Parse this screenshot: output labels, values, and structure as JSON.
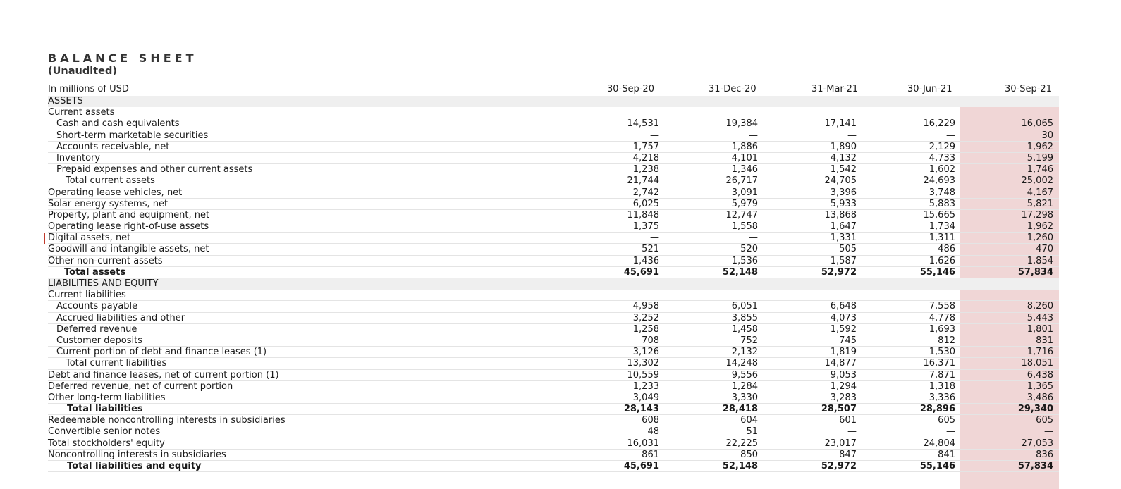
{
  "title": "BALANCE SHEET",
  "subtitle": "(Unaudited)",
  "unit_label": "In millions of USD",
  "columns": [
    "30-Sep-20",
    "31-Dec-20",
    "31-Mar-21",
    "30-Jun-21",
    "30-Sep-21"
  ],
  "highlight_color": "#f0d6d6",
  "rows": [
    {
      "label": "ASSETS",
      "type": "section",
      "indent": 0,
      "values": [
        "",
        "",
        "",
        "",
        ""
      ]
    },
    {
      "label": "Current assets",
      "type": "plain",
      "indent": 0,
      "values": [
        "",
        "",
        "",
        "",
        ""
      ]
    },
    {
      "label": "Cash and cash equivalents",
      "type": "plain",
      "indent": 1,
      "values": [
        "14,531",
        "19,384",
        "17,141",
        "16,229",
        "16,065"
      ]
    },
    {
      "label": "Short-term marketable securities",
      "type": "plain",
      "indent": 1,
      "values": [
        "—",
        "—",
        "—",
        "—",
        "30"
      ]
    },
    {
      "label": "Accounts receivable, net",
      "type": "plain",
      "indent": 1,
      "values": [
        "1,757",
        "1,886",
        "1,890",
        "2,129",
        "1,962"
      ]
    },
    {
      "label": "Inventory",
      "type": "plain",
      "indent": 1,
      "values": [
        "4,218",
        "4,101",
        "4,132",
        "4,733",
        "5,199"
      ]
    },
    {
      "label": "Prepaid expenses and other current assets",
      "type": "plain",
      "indent": 1,
      "values": [
        "1,238",
        "1,346",
        "1,542",
        "1,602",
        "1,746"
      ]
    },
    {
      "label": "Total current assets",
      "type": "plain",
      "indent": 2,
      "values": [
        "21,744",
        "26,717",
        "24,705",
        "24,693",
        "25,002"
      ]
    },
    {
      "label": "Operating lease vehicles, net",
      "type": "plain",
      "indent": 0,
      "values": [
        "2,742",
        "3,091",
        "3,396",
        "3,748",
        "4,167"
      ]
    },
    {
      "label": "Solar energy systems, net",
      "type": "plain",
      "indent": 0,
      "values": [
        "6,025",
        "5,979",
        "5,933",
        "5,883",
        "5,821"
      ]
    },
    {
      "label": "Property, plant and equipment, net",
      "type": "plain",
      "indent": 0,
      "values": [
        "11,848",
        "12,747",
        "13,868",
        "15,665",
        "17,298"
      ]
    },
    {
      "label": "Operating lease right-of-use assets",
      "type": "plain",
      "indent": 0,
      "values": [
        "1,375",
        "1,558",
        "1,647",
        "1,734",
        "1,962"
      ]
    },
    {
      "label": "Digital assets, net",
      "type": "plain",
      "indent": 0,
      "values": [
        "—",
        "—",
        "1,331",
        "1,311",
        "1,260"
      ]
    },
    {
      "label": "Goodwill and intangible assets, net",
      "type": "plain",
      "indent": 0,
      "values": [
        "521",
        "520",
        "505",
        "486",
        "470"
      ]
    },
    {
      "label": "Other non-current assets",
      "type": "plain",
      "indent": 0,
      "values": [
        "1,436",
        "1,536",
        "1,587",
        "1,626",
        "1,854"
      ]
    },
    {
      "label": "Total assets",
      "type": "bold",
      "indent": 3,
      "values": [
        "45,691",
        "52,148",
        "52,972",
        "55,146",
        "57,834"
      ]
    },
    {
      "label": "LIABILITIES AND EQUITY",
      "type": "section",
      "indent": 0,
      "values": [
        "",
        "",
        "",
        "",
        ""
      ]
    },
    {
      "label": "Current liabilities",
      "type": "plain",
      "indent": 0,
      "values": [
        "",
        "",
        "",
        "",
        ""
      ]
    },
    {
      "label": "Accounts payable",
      "type": "plain",
      "indent": 1,
      "values": [
        "4,958",
        "6,051",
        "6,648",
        "7,558",
        "8,260"
      ]
    },
    {
      "label": "Accrued liabilities and other",
      "type": "plain",
      "indent": 1,
      "values": [
        "3,252",
        "3,855",
        "4,073",
        "4,778",
        "5,443"
      ]
    },
    {
      "label": "Deferred revenue",
      "type": "plain",
      "indent": 1,
      "values": [
        "1,258",
        "1,458",
        "1,592",
        "1,693",
        "1,801"
      ]
    },
    {
      "label": "Customer deposits",
      "type": "plain",
      "indent": 1,
      "values": [
        "708",
        "752",
        "745",
        "812",
        "831"
      ]
    },
    {
      "label": "Current portion of debt and finance leases (1)",
      "type": "plain",
      "indent": 1,
      "values": [
        "3,126",
        "2,132",
        "1,819",
        "1,530",
        "1,716"
      ]
    },
    {
      "label": "Total current liabilities",
      "type": "plain",
      "indent": 2,
      "values": [
        "13,302",
        "14,248",
        "14,877",
        "16,371",
        "18,051"
      ]
    },
    {
      "label": "Debt and finance leases, net of current portion (1)",
      "type": "plain",
      "indent": 0,
      "values": [
        "10,559",
        "9,556",
        "9,053",
        "7,871",
        "6,438"
      ]
    },
    {
      "label": "Deferred revenue, net of current portion",
      "type": "plain",
      "indent": 0,
      "values": [
        "1,233",
        "1,284",
        "1,294",
        "1,318",
        "1,365"
      ]
    },
    {
      "label": "Other long-term liabilities",
      "type": "plain",
      "indent": 0,
      "values": [
        "3,049",
        "3,330",
        "3,283",
        "3,336",
        "3,486"
      ]
    },
    {
      "label": "Total liabilities",
      "type": "bold",
      "indent": 4,
      "values": [
        "28,143",
        "28,418",
        "28,507",
        "28,896",
        "29,340"
      ]
    },
    {
      "label": "Redeemable noncontrolling interests in subsidiaries",
      "type": "plain",
      "indent": 0,
      "values": [
        "608",
        "604",
        "601",
        "605",
        "605"
      ]
    },
    {
      "label": "Convertible senior notes",
      "type": "plain",
      "indent": 0,
      "values": [
        "48",
        "51",
        "—",
        "—",
        "—"
      ]
    },
    {
      "label": "Total stockholders' equity",
      "type": "plain",
      "indent": 0,
      "values": [
        "16,031",
        "22,225",
        "23,017",
        "24,804",
        "27,053"
      ]
    },
    {
      "label": "Noncontrolling interests in subsidiaries",
      "type": "plain",
      "indent": 0,
      "values": [
        "861",
        "850",
        "847",
        "841",
        "836"
      ]
    },
    {
      "label": "Total liabilities and equity",
      "type": "bold",
      "indent": 4,
      "values": [
        "45,691",
        "52,148",
        "52,972",
        "55,146",
        "57,834"
      ]
    }
  ]
}
